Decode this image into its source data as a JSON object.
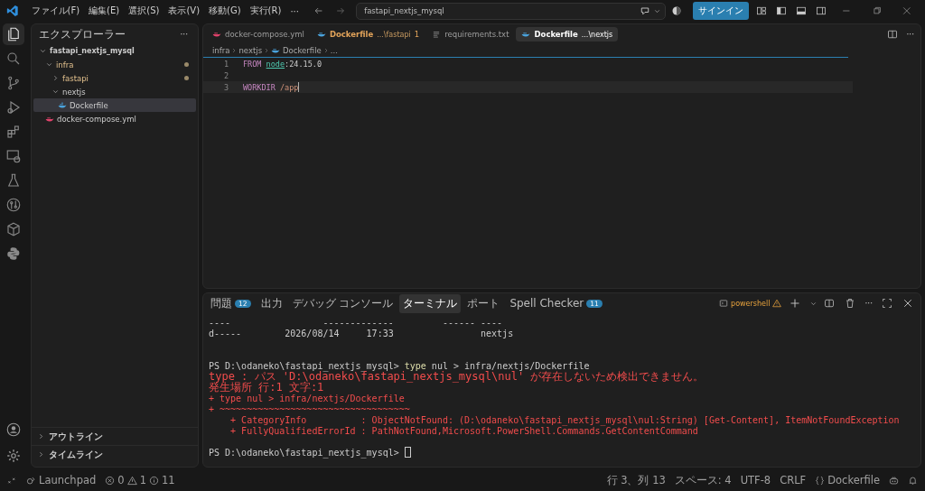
{
  "title_bar": {
    "menu": [
      "ファイル(F)",
      "編集(E)",
      "選択(S)",
      "表示(V)",
      "移動(G)",
      "実行(R)",
      "···"
    ],
    "search": "fastapi_nextjs_mysql",
    "sign_in": "サインイン"
  },
  "activity_bar": {
    "items": [
      {
        "selected": true
      },
      {
        "selected": false
      },
      {
        "selected": false
      },
      {
        "selected": false
      },
      {
        "selected": false
      },
      {
        "selected": false
      },
      {
        "selected": false
      },
      {
        "selected": false
      },
      {
        "selected": false
      },
      {
        "selected": false
      }
    ]
  },
  "sidebar": {
    "title": "エクスプローラー",
    "more": "···",
    "tree": [
      {
        "label": "fastapi_nextjs_mysql",
        "kind": "folder",
        "expanded": true,
        "children": [
          {
            "label": "infra",
            "kind": "folder",
            "expanded": true,
            "modified": true,
            "children": [
              {
                "label": "fastapi",
                "kind": "folder",
                "expanded": false,
                "modified": true
              },
              {
                "label": "nextjs",
                "kind": "folder",
                "expanded": true,
                "children": [
                  {
                    "label": "Dockerfile",
                    "kind": "docker",
                    "selected": true
                  }
                ]
              }
            ]
          },
          {
            "label": "docker-compose.yml",
            "kind": "compose",
            "selected": false
          }
        ]
      }
    ],
    "sections": [
      {
        "label": "アウトライン",
        "expanded": false
      },
      {
        "label": "タイムライン",
        "expanded": false
      }
    ]
  },
  "editor": {
    "tabs": [
      {
        "label": "docker-compose.yml",
        "kind": "compose",
        "selected": false
      },
      {
        "label": "Dockerfile",
        "detail": "...\\fastapi",
        "badge": "1",
        "kind": "docker",
        "warning": true,
        "selected": false
      },
      {
        "label": "requirements.txt",
        "kind": "text",
        "selected": false
      },
      {
        "label": "Dockerfile",
        "detail": "...\\nextjs",
        "kind": "docker",
        "selected": true
      }
    ],
    "more": "···",
    "breadcrumb": [
      {
        "label": "infra",
        "kind": "text"
      },
      {
        "label": "nextjs",
        "kind": "text"
      },
      {
        "label": "Dockerfile",
        "kind": "docker"
      },
      {
        "label": "...",
        "kind": "text"
      }
    ],
    "lines": [
      {
        "number": "1",
        "tokens": [
          {
            "text": "FROM ",
            "kind": "keyword"
          },
          {
            "text": "node",
            "kind": "image"
          },
          {
            "text": ":24.15.0",
            "kind": "plain"
          }
        ]
      },
      {
        "number": "2"
      },
      {
        "number": "3",
        "current": true,
        "cursor": true,
        "tokens": [
          {
            "text": "WORKDIR ",
            "kind": "keyword"
          },
          {
            "text": "/app",
            "kind": "path"
          }
        ]
      }
    ]
  },
  "panel": {
    "tabs": [
      {
        "label": "問題",
        "badge": "12",
        "selected": false
      },
      {
        "label": "出力",
        "selected": false
      },
      {
        "label": "デバッグ コンソール",
        "selected": false
      },
      {
        "label": "ターミナル",
        "selected": true
      },
      {
        "label": "ポート",
        "selected": false
      },
      {
        "label": "Spell Checker",
        "badge": "11",
        "selected": false
      }
    ],
    "shell": "powershell",
    "more": "···",
    "terminal": [
      {
        "kind": "plain",
        "tokens": [
          {
            "text": "----                 -------------         ------ ----",
            "kind": "plain"
          }
        ]
      },
      {
        "kind": "plain",
        "tokens": [
          {
            "text": "d-----        2026/08/14     17:33                nextjs",
            "kind": "plain"
          }
        ]
      },
      {
        "kind": "blank"
      },
      {
        "kind": "blank"
      },
      {
        "kind": "prompt",
        "tokens": [
          {
            "text": "PS D:\\odaneko\\fastapi_nextjs_mysql> ",
            "kind": "plain"
          },
          {
            "text": "type",
            "kind": "command"
          },
          {
            "text": " nul > infra/nextjs/Dockerfile",
            "kind": "plain"
          }
        ]
      },
      {
        "kind": "error",
        "tokens": [
          {
            "text": "type : パス 'D:\\odaneko\\fastapi_nextjs_mysql\\nul' が存在しないため検出できません。",
            "kind": "message"
          }
        ]
      },
      {
        "kind": "error",
        "tokens": [
          {
            "text": "発生場所 行:1 文字:1",
            "kind": "message"
          }
        ]
      },
      {
        "kind": "error",
        "tokens": [
          {
            "text": "+ type nul > infra/nextjs/Dockerfile",
            "kind": "error"
          }
        ]
      },
      {
        "kind": "error",
        "tokens": [
          {
            "text": "+ ~~~~~~~~~~~~~~~~~~~~~~~~~~~~~~~~~~~",
            "kind": "error"
          }
        ]
      },
      {
        "kind": "error",
        "tokens": [
          {
            "text": "    + CategoryInfo          : ObjectNotFound: (D:\\odaneko\\fastapi_nextjs_mysql\\nul:String) [Get-Content], ItemNotFoundException",
            "kind": "error"
          }
        ]
      },
      {
        "kind": "error",
        "tokens": [
          {
            "text": "    + FullyQualifiedErrorId : PathNotFound,Microsoft.PowerShell.Commands.GetContentCommand",
            "kind": "error"
          }
        ]
      },
      {
        "kind": "blank"
      },
      {
        "kind": "prompt",
        "cursor": true,
        "tokens": [
          {
            "text": "PS D:\\odaneko\\fastapi_nextjs_mysql> ",
            "kind": "plain"
          }
        ]
      }
    ]
  },
  "status_bar": {
    "launchpad": "Launchpad",
    "errors": "0",
    "warnings": "1",
    "infos": "11",
    "right": [
      {
        "text": "行 3、列 13",
        "kind": "plain"
      },
      {
        "text": "スペース: 4",
        "kind": "plain"
      },
      {
        "text": "UTF-8",
        "kind": "plain"
      },
      {
        "text": "CRLF",
        "kind": "plain"
      },
      {
        "text": "Dockerfile",
        "kind": "language"
      }
    ]
  }
}
